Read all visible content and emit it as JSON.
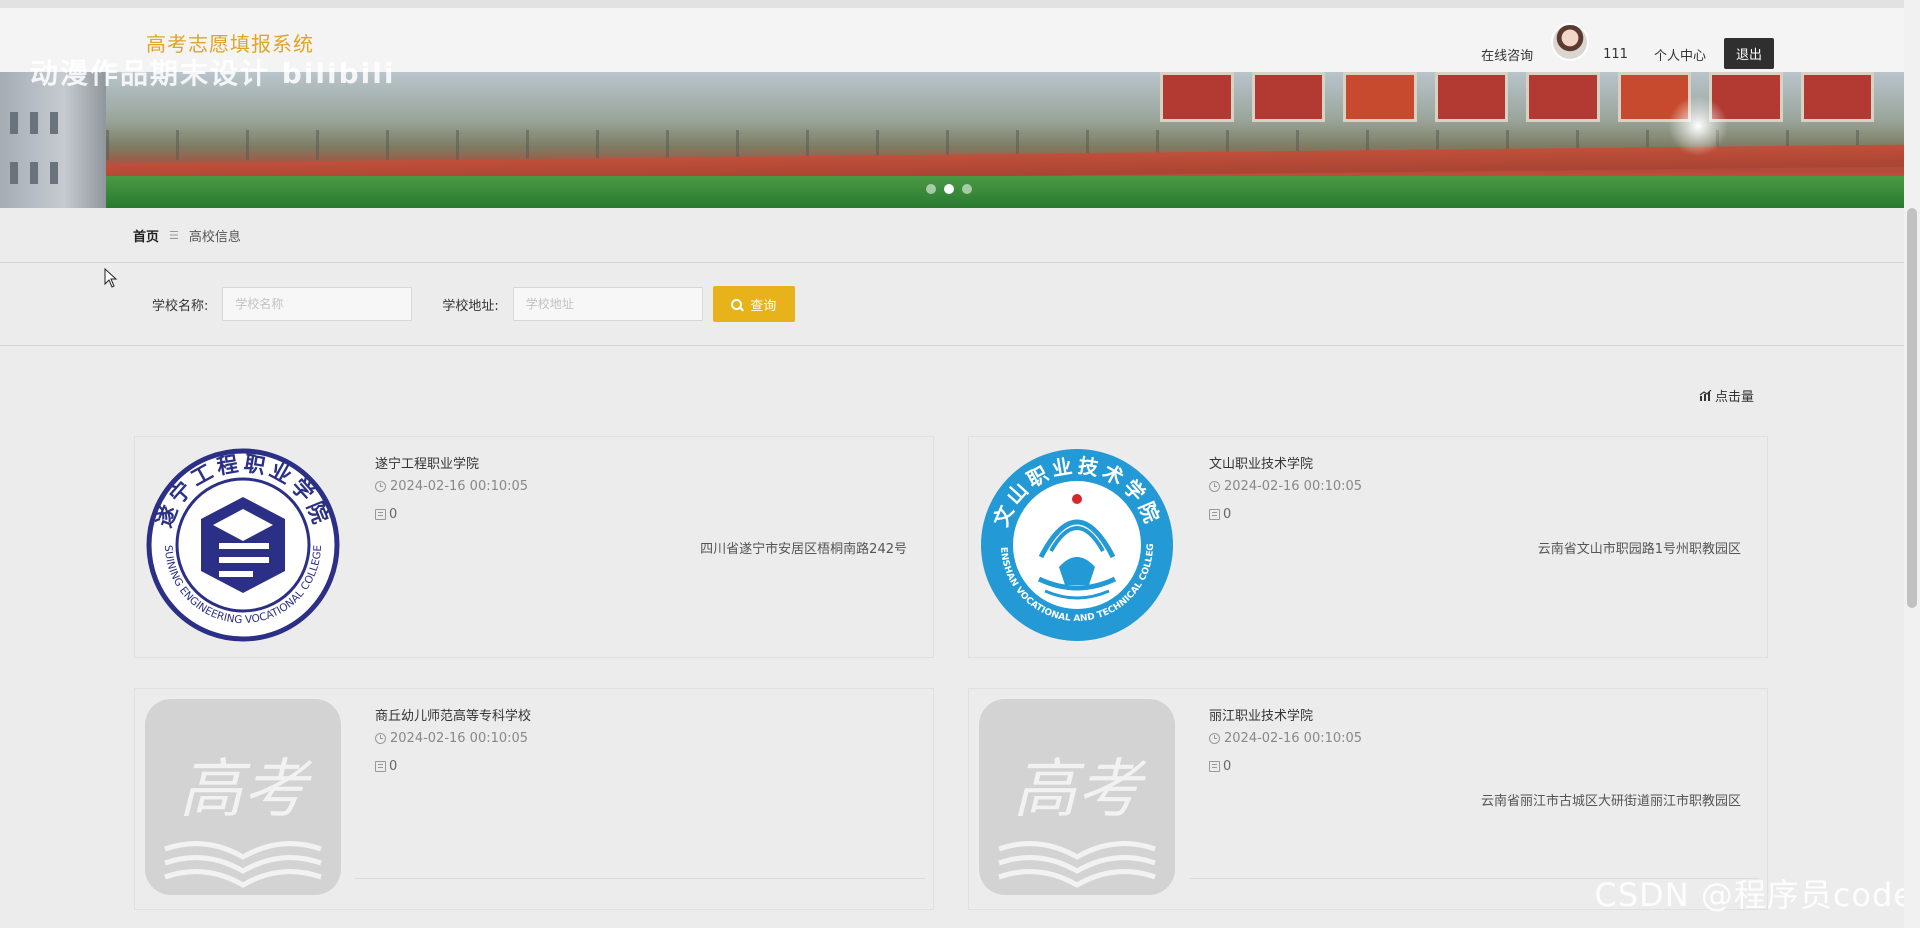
{
  "header": {
    "site_title": "高考志愿填报系统",
    "overlay_text": "动漫作品期末设计 bilibili",
    "nav": {
      "consult": "在线咨询",
      "user": "111",
      "profile": "个人中心",
      "logout": "退出"
    }
  },
  "banner": {
    "slides_count": 3,
    "active_slide": 2
  },
  "breadcrumb": {
    "home": "首页",
    "separator": "☰",
    "current": "高校信息"
  },
  "search": {
    "name_label": "学校名称:",
    "name_placeholder": "学校名称",
    "address_label": "学校地址:",
    "address_placeholder": "学校地址",
    "button_label": "查询"
  },
  "sort": {
    "label": "点击量",
    "icon": "chart-icon"
  },
  "schools": [
    {
      "name": "遂宁工程职业学院",
      "time": "2024-02-16 00:10:05",
      "views": "0",
      "address": "四川省遂宁市安居区梧桐南路242号",
      "logo": "suining-logo"
    },
    {
      "name": "文山职业技术学院",
      "time": "2024-02-16 00:10:05",
      "views": "0",
      "address": "云南省文山市职园路1号州职教园区",
      "logo": "wenshan-logo"
    },
    {
      "name": "商丘幼儿师范高等专科学校",
      "time": "2024-02-16 00:10:05",
      "views": "0",
      "address": "",
      "logo": "gaokao-placeholder"
    },
    {
      "name": "丽江职业技术学院",
      "time": "2024-02-16 00:10:05",
      "views": "0",
      "address": "云南省丽江市古城区大研街道丽江市职教园区",
      "logo": "gaokao-placeholder"
    }
  ],
  "logos": {
    "suining": {
      "top_text": "遂宁工程职业学院",
      "bottom_text": "SUINING ENGINEERING VOCATIONAL COLLEGE",
      "color": "#2b2f86"
    },
    "wenshan": {
      "top_text": "文山职业技术学院",
      "bottom_text": "WENSHAN VOCATIONAL AND TECHNICAL COLLEGE",
      "color": "#2399d6"
    },
    "placeholder": {
      "text": "高考"
    }
  },
  "watermark": "CSDN @程序员code",
  "colors": {
    "accent": "#e8b21a",
    "title": "#e0a524",
    "logout_bg": "#2f2f2f"
  }
}
